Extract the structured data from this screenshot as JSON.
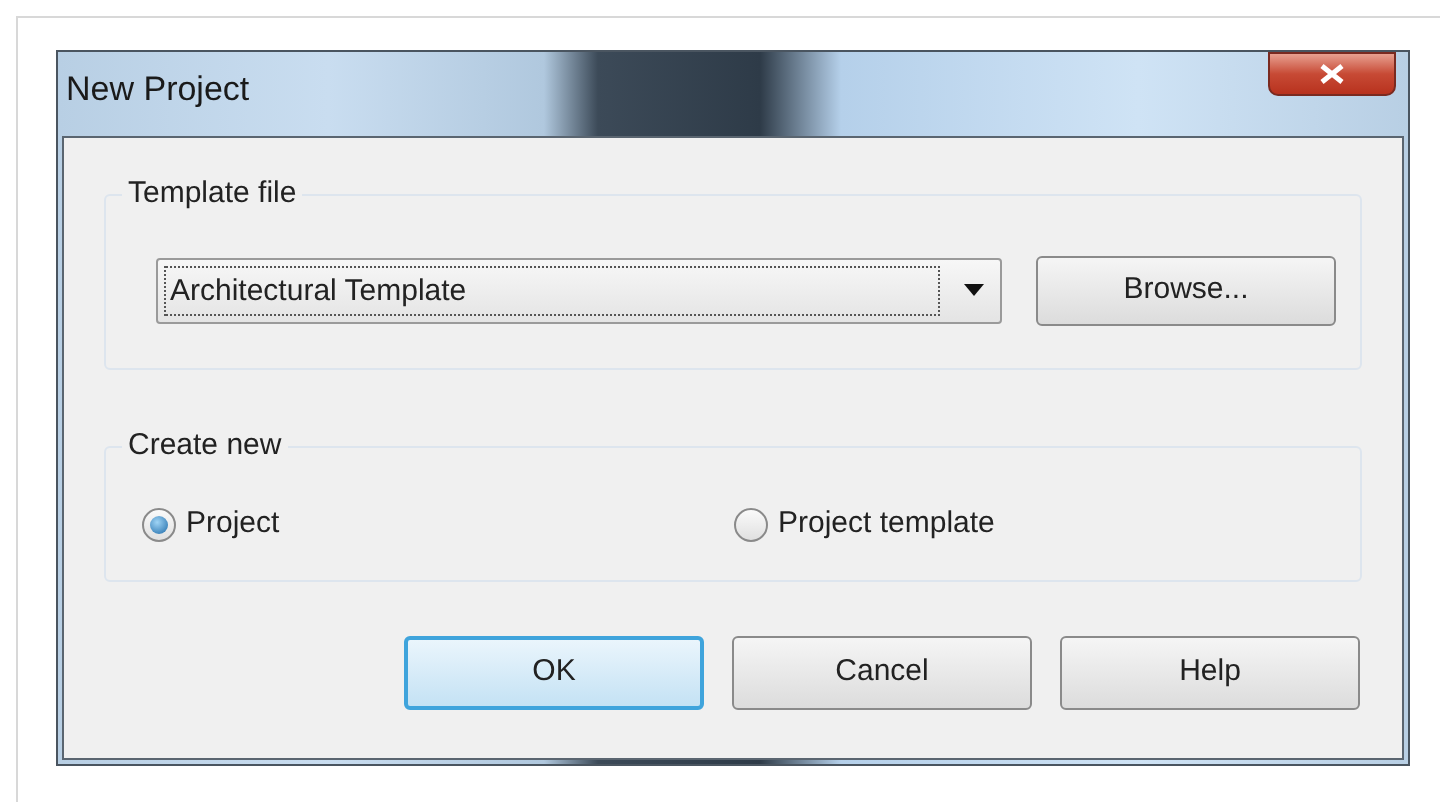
{
  "window": {
    "title": "New Project"
  },
  "template_file": {
    "label": "Template file",
    "value": "Architectural Template",
    "browse_button": "Browse..."
  },
  "create_new": {
    "label": "Create new",
    "options": [
      {
        "label": "Project",
        "selected": true
      },
      {
        "label": "Project template",
        "selected": false
      }
    ]
  },
  "buttons": [
    {
      "label": "OK",
      "default": true
    },
    {
      "label": "Cancel",
      "default": false
    },
    {
      "label": "Help",
      "default": false
    }
  ]
}
